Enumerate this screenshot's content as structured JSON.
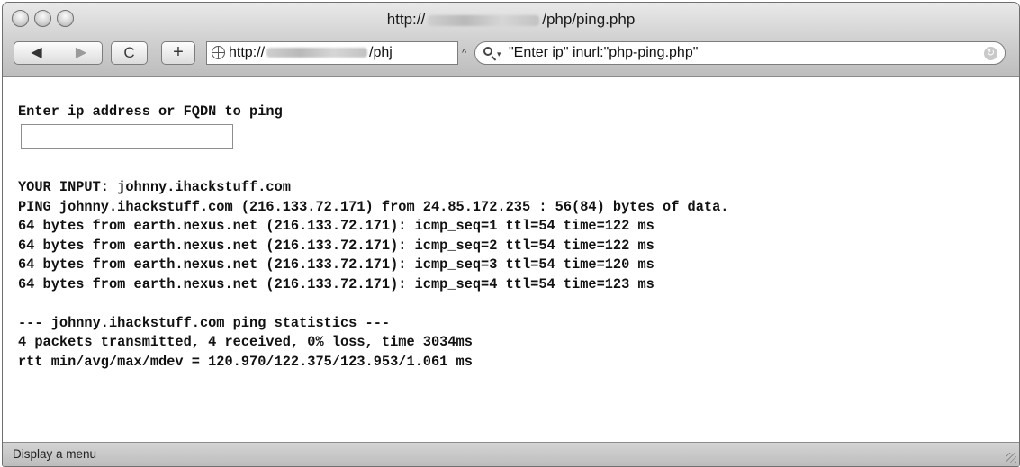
{
  "window": {
    "title_prefix": "http://",
    "title_suffix": "/php/ping.php"
  },
  "toolbar": {
    "back_glyph": "◀",
    "forward_glyph": "▶",
    "reload_glyph": "C",
    "add_glyph": "+",
    "url_prefix": "http://",
    "url_suffix": "/phj",
    "url_chevron": "^",
    "search_query": "\"Enter ip\" inurl:\"php-ping.php\"",
    "search_dropdown_glyph": "▾",
    "snapback_glyph": "↻"
  },
  "page": {
    "prompt": "Enter ip address or FQDN to ping",
    "input_value": "",
    "output_lines": [
      "YOUR INPUT: johnny.ihackstuff.com",
      "PING johnny.ihackstuff.com (216.133.72.171) from 24.85.172.235 : 56(84) bytes of data.",
      "64 bytes from earth.nexus.net (216.133.72.171): icmp_seq=1 ttl=54 time=122 ms",
      "64 bytes from earth.nexus.net (216.133.72.171): icmp_seq=2 ttl=54 time=122 ms",
      "64 bytes from earth.nexus.net (216.133.72.171): icmp_seq=3 ttl=54 time=120 ms",
      "64 bytes from earth.nexus.net (216.133.72.171): icmp_seq=4 ttl=54 time=123 ms",
      "",
      "--- johnny.ihackstuff.com ping statistics ---",
      "4 packets transmitted, 4 received, 0% loss, time 3034ms",
      "rtt min/avg/max/mdev = 120.970/122.375/123.953/1.061 ms"
    ]
  },
  "statusbar": {
    "text": "Display a menu"
  }
}
